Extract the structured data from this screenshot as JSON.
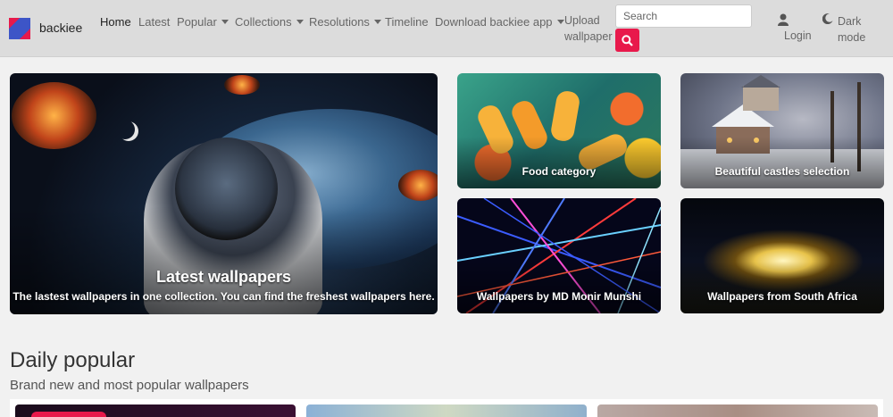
{
  "header": {
    "brand": "backiee",
    "nav": {
      "home": "Home",
      "latest": "Latest",
      "popular": "Popular",
      "collections": "Collections",
      "resolutions": "Resolutions",
      "timeline": "Timeline",
      "download_app": "Download backiee app"
    },
    "upload": "Upload wallpaper",
    "search_placeholder": "Search",
    "login": "Login",
    "dark_mode": "Dark mode",
    "colors": {
      "accent": "#e8194b",
      "navbar": "#dcdcdc"
    },
    "icons": [
      "backiee-logo-icon",
      "caret-down-icon",
      "search-icon",
      "user-icon",
      "moon-icon"
    ]
  },
  "featured": {
    "hero": {
      "title": "Latest wallpapers",
      "subtitle": "The lastest wallpapers in one collection. You can find the freshest wallpapers here."
    },
    "collections": [
      {
        "label": "Food category"
      },
      {
        "label": "Beautiful castles selection"
      },
      {
        "label": "Wallpapers by MD Monir Munshi"
      },
      {
        "label": "Wallpapers from South Africa"
      }
    ]
  },
  "daily": {
    "title": "Daily popular",
    "subtitle": "Brand new and most popular wallpapers"
  }
}
